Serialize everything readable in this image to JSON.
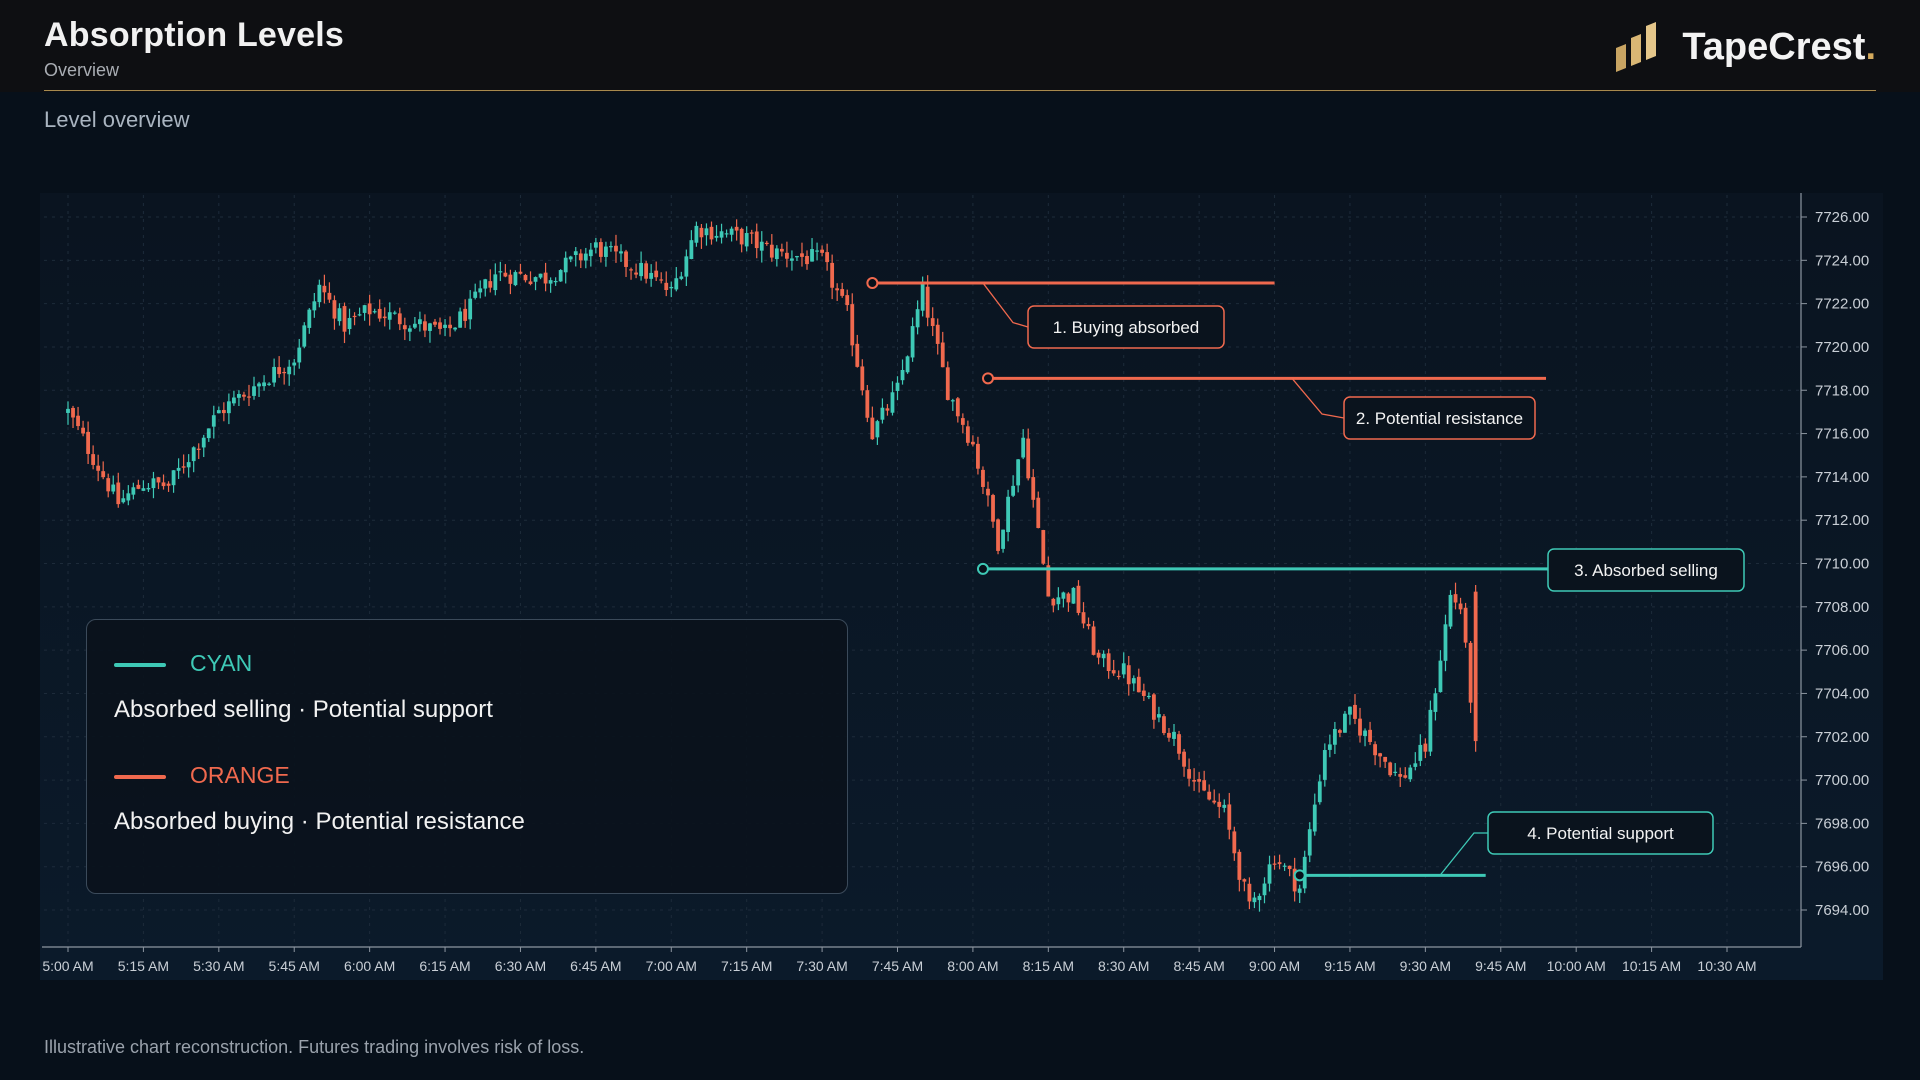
{
  "header": {
    "title": "Absorption Levels",
    "subtitle": "Overview",
    "brand_name": "TapeCrest",
    "brand_dot": "."
  },
  "section_label": "Level overview",
  "legend": {
    "items": [
      {
        "key": "CYAN",
        "desc": "Absorbed selling · Potential support",
        "color": "#3ec9b6"
      },
      {
        "key": "ORANGE",
        "desc": "Absorbed buying · Potential resistance",
        "color": "#f0694e"
      }
    ]
  },
  "footer": "Illustrative chart reconstruction. Futures trading involves risk of loss.",
  "colors": {
    "up": "#3ec9b6",
    "down": "#f0694e",
    "accent": "#d4aa5c",
    "background": "#07101a"
  },
  "chart_data": {
    "type": "candlestick",
    "x_ticks": [
      "5:00 AM",
      "5:15 AM",
      "5:30 AM",
      "5:45 AM",
      "6:00 AM",
      "6:15 AM",
      "6:30 AM",
      "6:45 AM",
      "7:00 AM",
      "7:15 AM",
      "7:30 AM",
      "7:45 AM",
      "8:00 AM",
      "8:15 AM",
      "8:30 AM",
      "8:45 AM",
      "9:00 AM",
      "9:15 AM",
      "9:30 AM",
      "9:45 AM",
      "10:00 AM",
      "10:15 AM",
      "10:30 AM"
    ],
    "y_ticks": [
      "7726.00",
      "7724.00",
      "7722.00",
      "7720.00",
      "7718.00",
      "7716.00",
      "7714.00",
      "7712.00",
      "7710.00",
      "7708.00",
      "7706.00",
      "7704.00",
      "7702.00",
      "7700.00",
      "7698.00",
      "7696.00",
      "7694.00"
    ],
    "ylim": [
      7693.0,
      7726.8
    ],
    "xlim_minutes": [
      0,
      345
    ],
    "grid": true,
    "legend_position": "bottom-left",
    "price_path": [
      {
        "t": "5:00 AM",
        "price": 7717.0
      },
      {
        "t": "5:10 AM",
        "price": 7712.8
      },
      {
        "t": "5:15 AM",
        "price": 7713.7
      },
      {
        "t": "5:20 AM",
        "price": 7713.6
      },
      {
        "t": "5:30 AM",
        "price": 7717.0
      },
      {
        "t": "5:45 AM",
        "price": 7719.5
      },
      {
        "t": "5:50 AM",
        "price": 7722.8
      },
      {
        "t": "5:55 AM",
        "price": 7721.0
      },
      {
        "t": "6:00 AM",
        "price": 7721.7
      },
      {
        "t": "6:10 AM",
        "price": 7721.0
      },
      {
        "t": "6:15 AM",
        "price": 7720.6
      },
      {
        "t": "6:20 AM",
        "price": 7721.8
      },
      {
        "t": "6:25 AM",
        "price": 7723.4
      },
      {
        "t": "6:35 AM",
        "price": 7723.2
      },
      {
        "t": "6:40 AM",
        "price": 7723.9
      },
      {
        "t": "6:45 AM",
        "price": 7724.6
      },
      {
        "t": "6:55 AM",
        "price": 7723.4
      },
      {
        "t": "7:00 AM",
        "price": 7722.5
      },
      {
        "t": "7:05 AM",
        "price": 7725.5
      },
      {
        "t": "7:15 AM",
        "price": 7725.0
      },
      {
        "t": "7:20 AM",
        "price": 7724.4
      },
      {
        "t": "7:30 AM",
        "price": 7724.0
      },
      {
        "t": "7:35 AM",
        "price": 7721.5
      },
      {
        "t": "7:40 AM",
        "price": 7716.0
      },
      {
        "t": "7:45 AM",
        "price": 7718.0
      },
      {
        "t": "7:50 AM",
        "price": 7722.5
      },
      {
        "t": "7:55 AM",
        "price": 7718.0
      },
      {
        "t": "8:00 AM",
        "price": 7715.5
      },
      {
        "t": "8:05 AM",
        "price": 7711.0
      },
      {
        "t": "8:10 AM",
        "price": 7715.8
      },
      {
        "t": "8:15 AM",
        "price": 7708.5
      },
      {
        "t": "8:20 AM",
        "price": 7708.5
      },
      {
        "t": "8:25 AM",
        "price": 7705.5
      },
      {
        "t": "8:30 AM",
        "price": 7705.0
      },
      {
        "t": "8:40 AM",
        "price": 7702.0
      },
      {
        "t": "8:45 AM",
        "price": 7699.5
      },
      {
        "t": "8:50 AM",
        "price": 7698.5
      },
      {
        "t": "8:55 AM",
        "price": 7694.0
      },
      {
        "t": "9:00 AM",
        "price": 7696.5
      },
      {
        "t": "9:05 AM",
        "price": 7695.0
      },
      {
        "t": "9:10 AM",
        "price": 7701.5
      },
      {
        "t": "9:15 AM",
        "price": 7703.0
      },
      {
        "t": "9:25 AM",
        "price": 7700.0
      },
      {
        "t": "9:30 AM",
        "price": 7701.5
      },
      {
        "t": "9:35 AM",
        "price": 7708.5
      },
      {
        "t": "9:37 AM",
        "price": 7708.0
      },
      {
        "t": "9:40 AM",
        "price": 7701.8
      }
    ],
    "levels": [
      {
        "name": "1. Buying absorbed",
        "price": 7722.95,
        "color": "orange",
        "start": "7:40 AM",
        "end": "9:00 AM"
      },
      {
        "name": "2. Potential resistance",
        "price": 7718.55,
        "color": "orange",
        "start": "8:03 AM",
        "end": "9:54 AM"
      },
      {
        "name": "3. Absorbed selling",
        "price": 7709.75,
        "color": "cyan",
        "start": "8:02 AM",
        "end": "9:59 AM"
      },
      {
        "name": "4. Potential support",
        "price": 7695.6,
        "color": "cyan",
        "start": "9:05 AM",
        "end": "9:42 AM"
      }
    ]
  }
}
